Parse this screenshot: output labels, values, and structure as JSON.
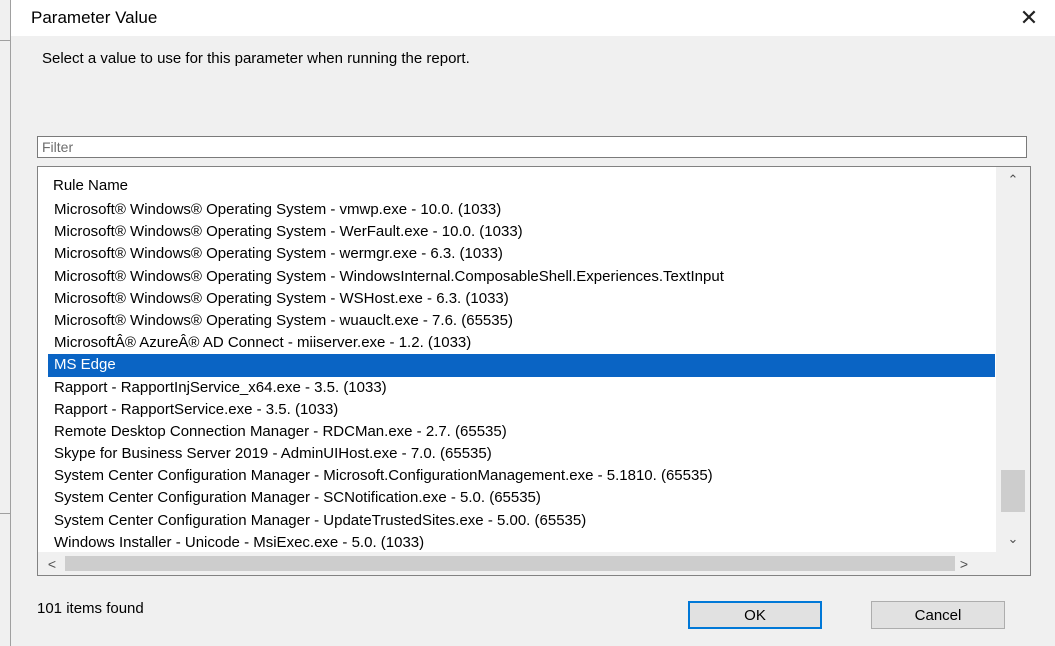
{
  "dialog": {
    "title": "Parameter Value",
    "close_glyph": "✕",
    "instruction": "Select a value to use for this parameter when running the report."
  },
  "filter": {
    "value": "",
    "placeholder": "Filter"
  },
  "list": {
    "column_header": "Rule Name",
    "rows": [
      "Microsoft® Windows® Operating System - vmwp.exe - 10.0. (1033)",
      "Microsoft® Windows® Operating System - WerFault.exe - 10.0. (1033)",
      "Microsoft® Windows® Operating System - wermgr.exe - 6.3. (1033)",
      "Microsoft® Windows® Operating System - WindowsInternal.ComposableShell.Experiences.TextInput",
      "Microsoft® Windows® Operating System - WSHost.exe - 6.3. (1033)",
      "Microsoft® Windows® Operating System - wuauclt.exe - 7.6. (65535)",
      "MicrosoftÂ® AzureÂ® AD Connect - miiserver.exe - 1.2. (1033)",
      "MS Edge",
      "Rapport - RapportInjService_x64.exe - 3.5. (1033)",
      "Rapport - RapportService.exe - 3.5. (1033)",
      "Remote Desktop Connection Manager - RDCMan.exe - 2.7. (65535)",
      "Skype for Business Server 2019 - AdminUIHost.exe - 7.0. (65535)",
      "System Center Configuration Manager - Microsoft.ConfigurationManagement.exe - 5.1810. (65535)",
      "System Center Configuration Manager - SCNotification.exe - 5.0. (65535)",
      "System Center Configuration Manager - UpdateTrustedSites.exe - 5.00. (65535)",
      "Windows Installer - Unicode - MsiExec.exe - 5.0. (1033)"
    ],
    "selected_index": 7,
    "selection_color": "#0a64c4"
  },
  "scrollbars": {
    "up_glyph": "⌃",
    "down_glyph": "⌄",
    "left_glyph": "<",
    "right_glyph": ">"
  },
  "footer": {
    "status": "101 items found",
    "ok_label": "OK",
    "cancel_label": "Cancel",
    "ok_border_color": "#0078d7"
  }
}
